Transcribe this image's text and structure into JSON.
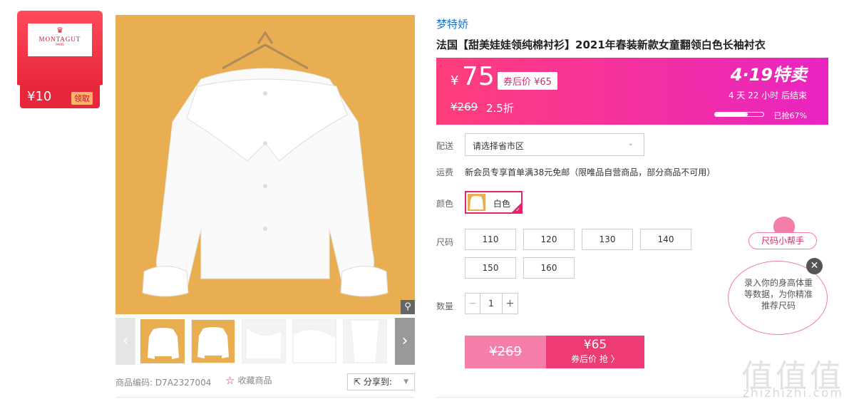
{
  "coupon": {
    "brand_logo": "MONTAGUT",
    "brand_logo_sub": "PARIS",
    "amount": "¥10",
    "button": "领取"
  },
  "gallery": {
    "zoom_icon": "magnifier-icon",
    "thumb_prev_icon": "chevron-left-icon",
    "thumb_next_icon": "chevron-right-icon",
    "product_code_label": "商品编码:",
    "product_code": "D7A2327004",
    "favorite_label": "收藏商品",
    "share_label": "分享到:"
  },
  "product": {
    "brand": "梦特娇",
    "title": "法国【甜美娃娃领纯棉衬衫】2021年春装新款女童翻领白色长袖衬衣"
  },
  "price": {
    "currency": "¥",
    "now": "75",
    "coupon_price": "券后价 ¥65",
    "original": "¥269",
    "discount": "2.5折",
    "promo_logo": "4·19特卖",
    "countdown": "4  天 22 小时 后结束",
    "sold_percent": 67,
    "sold_text": "已抢67%"
  },
  "delivery": {
    "label": "配送",
    "placeholder": "请选择省市区"
  },
  "shipping": {
    "label": "运费",
    "text": "新会员专享首单满38元免邮（限唯品自营商品，部分商品不可用）"
  },
  "color": {
    "label": "颜色",
    "selected": "白色"
  },
  "size": {
    "label": "尺码",
    "options": [
      "110",
      "120",
      "130",
      "140",
      "150",
      "160"
    ]
  },
  "quantity": {
    "label": "数量",
    "value": "1",
    "minus": "−",
    "plus": "+"
  },
  "buy": {
    "original": "¥269",
    "price": "¥65",
    "label": "券后价 抢 〉"
  },
  "size_helper": {
    "tag": "尺码小帮手",
    "bubble": "录入你的身高体重等数据，为你精准推荐尺码",
    "close_icon": "close-icon"
  },
  "watermark": {
    "glyphs": "值值值",
    "url": "zhizhizhi.com"
  }
}
